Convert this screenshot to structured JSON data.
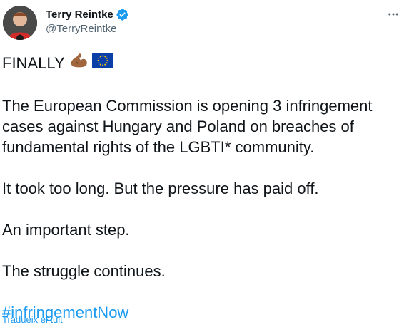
{
  "author": {
    "display_name": "Terry Reintke",
    "handle": "@TerryReintke"
  },
  "icons": {
    "verified": "verified-badge-icon",
    "more": "more-options-icon",
    "flexed_biceps": "flexed-biceps-emoji",
    "eu_flag": "eu-flag-emoji"
  },
  "tweet": {
    "line1": "FINALLY",
    "para1": "The European Commission is opening 3 infringement cases against Hungary and Poland on breaches of fundamental rights of the LGBTI* community.",
    "para2": "It took too long. But the pressure has paid off.",
    "para3": "An important step.",
    "para4": "The struggle continues.",
    "hashtag": "#infringementNow"
  },
  "translate_label": "Tradueix el tuit",
  "colors": {
    "accent": "#1d9bf0",
    "text": "#0f1419",
    "secondary": "#536471"
  }
}
